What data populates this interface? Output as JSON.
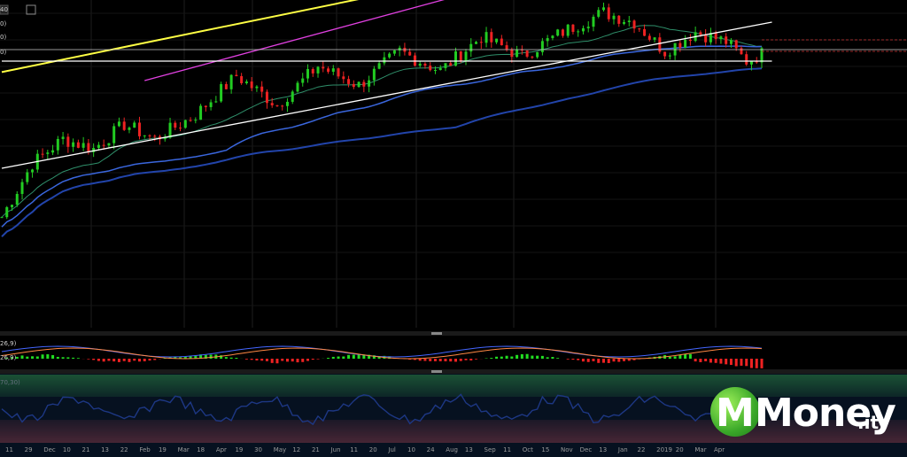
{
  "chart_data": [
    {
      "type": "candlestick",
      "panel": "price",
      "x_labels": [
        "11",
        "29",
        "Dec",
        "10",
        "21",
        "13",
        "22",
        "Feb",
        "19",
        "Mar",
        "18",
        "Apr",
        "19",
        "30",
        "May",
        "12",
        "21",
        "Jun",
        "11",
        "20",
        "Jul",
        "10",
        "24",
        "Aug",
        "13",
        "Sep",
        "11",
        "Oct",
        "15",
        "Nov",
        "Dec",
        "13",
        "Jan",
        "22",
        "2019",
        "20",
        "Mar",
        "Apr"
      ],
      "ylim": [
        0,
        100
      ],
      "candles": [],
      "candle_colors": {
        "up": "#22cc22",
        "down": "#ee2222"
      },
      "trend_lines": [
        {
          "name": "upper-yellow",
          "color": "#ffff44",
          "from": [
            0,
            79.5
          ],
          "to": [
            118,
            130
          ]
        },
        {
          "name": "upper-magenta",
          "color": "#e040e0",
          "from": [
            28,
            76
          ],
          "to": [
            118,
            127
          ]
        },
        {
          "name": "lower-white",
          "color": "#ffffff",
          "from": [
            0,
            40
          ],
          "to": [
            151,
            100
          ]
        },
        {
          "name": "support-white",
          "color": "#ffffff",
          "from": [
            0,
            84
          ],
          "to": [
            151,
            84
          ]
        }
      ],
      "moving_averages": [
        {
          "name": "ma-fast",
          "color": "#2f8f6a"
        },
        {
          "name": "ma-mid",
          "color": "#3a66dd"
        },
        {
          "name": "ma-slow",
          "color": "#2244aa"
        }
      ],
      "y_axis_partial_labels": [
        "40",
        "0)",
        "0)",
        "0)"
      ]
    },
    {
      "type": "macd",
      "panel": "macd",
      "labels": [
        "26,9)",
        "26,9)"
      ],
      "colors": {
        "pos": "#22dd22",
        "neg": "#ee2222",
        "line1": "#4466ff",
        "line2": "#ff8844"
      }
    },
    {
      "type": "line",
      "panel": "rsi",
      "labels": [
        "70,30)"
      ],
      "color": "#3355dd",
      "zones": {
        "upper": "#2f8f2f",
        "lower": "#8f2f2f"
      }
    }
  ],
  "logo": {
    "wordmark": "Money",
    "suffix": ".it",
    "badge_letter": "M"
  }
}
